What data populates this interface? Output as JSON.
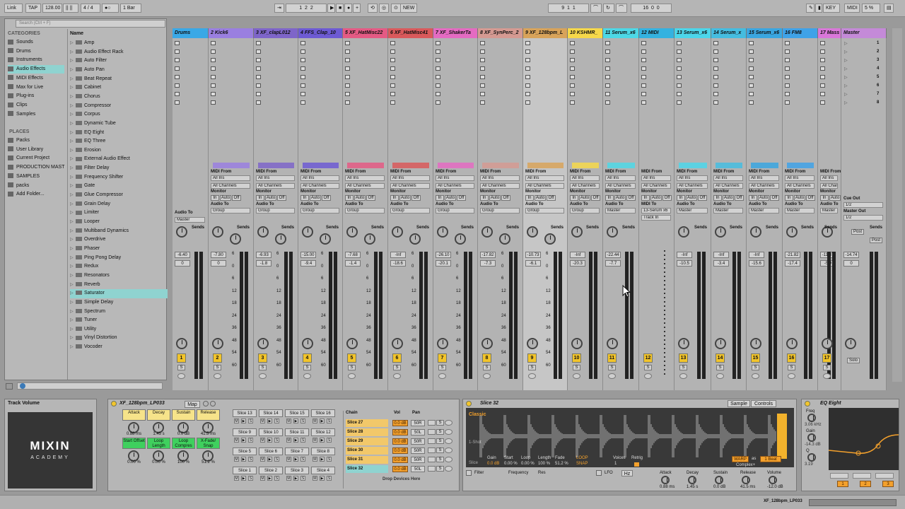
{
  "transport": {
    "link": "Link",
    "tap": "TAP",
    "tempo": "128.00",
    "signature": "4 / 4",
    "quantize": "1 Bar",
    "position": [
      "1",
      "2",
      "2"
    ],
    "new": "NEW",
    "loop_start": [
      "9",
      "1",
      "1"
    ],
    "loop_length": [
      "16",
      "0",
      "0"
    ],
    "key": "KEY",
    "midi": "MIDI",
    "cpu": "5 %"
  },
  "browser": {
    "search_placeholder": "Search (Ctrl + F)",
    "categories_title": "CATEGORIES",
    "categories": [
      {
        "label": "Sounds",
        "icon": "speaker-icon"
      },
      {
        "label": "Drums",
        "icon": "drum-icon"
      },
      {
        "label": "Instruments",
        "icon": "keys-icon"
      },
      {
        "label": "Audio Effects",
        "icon": "audio-fx-icon"
      },
      {
        "label": "MIDI Effects",
        "icon": "midi-fx-icon"
      },
      {
        "label": "Max for Live",
        "icon": "max-icon"
      },
      {
        "label": "Plug-ins",
        "icon": "plugin-icon"
      },
      {
        "label": "Clips",
        "icon": "clip-icon"
      },
      {
        "label": "Samples",
        "icon": "wave-icon"
      }
    ],
    "places_title": "PLACES",
    "places": [
      "Packs",
      "User Library",
      "Current Project",
      "PRODUCTION MAST",
      "SAMPLES",
      "packs",
      "Add Folder..."
    ],
    "name_header": "Name",
    "items": [
      "Amp",
      "Audio Effect Rack",
      "Auto Filter",
      "Auto Pan",
      "Beat Repeat",
      "Cabinet",
      "Chorus",
      "Compressor",
      "Corpus",
      "Dynamic Tube",
      "EQ Eight",
      "EQ Three",
      "Erosion",
      "External Audio Effect",
      "Filter Delay",
      "Frequency Shifter",
      "Gate",
      "Glue Compressor",
      "Grain Delay",
      "Limiter",
      "Looper",
      "Multiband Dynamics",
      "Overdrive",
      "Phaser",
      "Ping Pong Delay",
      "Redux",
      "Resonators",
      "Reverb",
      "Saturator",
      "Simple Delay",
      "Spectrum",
      "Tuner",
      "Utility",
      "Vinyl Distortion",
      "Vocoder"
    ]
  },
  "tracks": [
    {
      "name": "Drums",
      "color": "#3aa8e6",
      "num": "1",
      "vol": "-6.40",
      "pan": "0",
      "route": "Audio To",
      "dest": "Master"
    },
    {
      "name": "2 Kick6",
      "color": "#9a7fe0",
      "num": "2",
      "vol": "-7.80",
      "pan": "0",
      "route": "Audio To",
      "dest": "Group"
    },
    {
      "name": "3 XF_clapL012",
      "color": "#7e65c9",
      "num": "3",
      "vol": "-6.93",
      "pan": "-1.8",
      "route": "Audio To",
      "dest": "Group"
    },
    {
      "name": "4 FFS_Clap_10",
      "color": "#6d5ad3",
      "num": "4",
      "vol": "-15.00",
      "pan": "-9.4",
      "route": "Audio To",
      "dest": "Group"
    },
    {
      "name": "5 XF_HatMisc22",
      "color": "#e45a84",
      "num": "5",
      "vol": "-7.68",
      "pan": "-1.4",
      "route": "Audio To",
      "dest": "Group"
    },
    {
      "name": "6 XF_HatMisc41",
      "color": "#d9595b",
      "num": "6",
      "vol": "-Inf",
      "pan": "-18.6",
      "route": "Audio To",
      "dest": "Group"
    },
    {
      "name": "7 XF_ShakerTa",
      "color": "#e46bc2",
      "num": "7",
      "vol": "-26.10",
      "pan": "-20.1",
      "route": "Audio To",
      "dest": "Group"
    },
    {
      "name": "8 XF_SynPerc_2",
      "color": "#d59a92",
      "num": "8",
      "vol": "-17.82",
      "pan": "-7.3",
      "route": "Audio To",
      "dest": "Group"
    },
    {
      "name": "9 XF_128bpm_L",
      "color": "#d8a35a",
      "num": "9",
      "vol": "-10.73",
      "pan": "-6.1",
      "route": "Audio To",
      "dest": "Group"
    },
    {
      "name": "10 KSHMR_",
      "color": "#f6d84a",
      "num": "10",
      "vol": "-Inf",
      "pan": "-20.3",
      "route": "Audio To",
      "dest": "Group"
    },
    {
      "name": "11 Serum_x6",
      "color": "#4dd8e6",
      "num": "11",
      "vol": "-22.44",
      "pan": "-7.7",
      "route": "Audio To",
      "dest": "Master"
    },
    {
      "name": "12 MIDI",
      "color": "#34b2e0",
      "num": "12",
      "vol": "",
      "pan": "",
      "route": "MIDI To",
      "dest": "13-Serum x6"
    },
    {
      "name": "13 Serum_x6",
      "color": "#4cd6ea",
      "num": "13",
      "vol": "-Inf",
      "pan": "-10.5",
      "route": "Audio To",
      "dest": "Master"
    },
    {
      "name": "14 Serum_x",
      "color": "#45bde0",
      "num": "14",
      "vol": "-Inf",
      "pan": "-3.4",
      "route": "Audio To",
      "dest": "Master"
    },
    {
      "name": "15 Serum_x6",
      "color": "#3aa6e0",
      "num": "15",
      "vol": "-Inf",
      "pan": "-15.6",
      "route": "Audio To",
      "dest": "Master"
    },
    {
      "name": "16 FM8",
      "color": "#3fa2e8",
      "num": "16",
      "vol": "-21.82",
      "pan": "-17.4",
      "route": "Audio To",
      "dest": "Master"
    },
    {
      "name": "17 Mass",
      "color": "#d977d9",
      "num": "17",
      "vol": "-11.87",
      "pan": "-5.9",
      "route": "Audio To",
      "dest": "Master"
    }
  ],
  "master": {
    "name": "Master",
    "color": "#c48ad8",
    "vol": "-14.74",
    "pan": "0",
    "cue_out": "Cue Out",
    "cue_val": "1/2",
    "master_out": "Master Out",
    "master_val": "1/2",
    "scenes": [
      "1",
      "2",
      "3",
      "4",
      "5",
      "6",
      "7",
      "8"
    ]
  },
  "mixer_labels": {
    "midi_from": "MIDI From",
    "all_ins": "All Ins",
    "all_channels": "All Channels",
    "monitor": "Monitor",
    "in": "In",
    "auto": "Auto",
    "off": "Off",
    "sends": "Sends",
    "s": "S",
    "track_in": "Track In",
    "post": "Post",
    "solo": "Solo"
  },
  "db_scale": [
    "6",
    "0",
    "6",
    "12",
    "18",
    "24",
    "36",
    "48",
    "54",
    "60"
  ],
  "bottom": {
    "track_volume": "Track Volume",
    "logo_text": "MIXIN",
    "logo_sub": "ACADEMY",
    "rack_name": "XF_128bpm_LP033",
    "map": "Map",
    "macros": [
      {
        "label": "Attack",
        "value": "0.88 ms"
      },
      {
        "label": "Decay",
        "value": "1.45 s"
      },
      {
        "label": "Sustain",
        "value": "0.0 dB"
      },
      {
        "label": "Release",
        "value": "41.5 ms"
      },
      {
        "label": "Start Offset",
        "value": "0.00 %"
      },
      {
        "label": "Loop Length",
        "value": "0.00 %"
      },
      {
        "label": "Loop Compres",
        "value": "100 %"
      },
      {
        "label": "X-Fade/ Snap",
        "value": "51.2 %"
      }
    ],
    "pads": [
      "Slice 13",
      "Slice 14",
      "Slice 15",
      "Slice 16",
      "Slice 9",
      "Slice 10",
      "Slice 11",
      "Slice 12",
      "Slice 5",
      "Slice 6",
      "Slice 7",
      "Slice 8",
      "Slice 1",
      "Slice 2",
      "Slice 3",
      "Slice 4"
    ],
    "chain_header": [
      "Chain",
      "Vol",
      "Pan"
    ],
    "chains": [
      {
        "name": "Slice 27",
        "vol": "0.0 dB",
        "pan": "50R"
      },
      {
        "name": "Slice 28",
        "vol": "0.0 dB",
        "pan": "50L"
      },
      {
        "name": "Slice 29",
        "vol": "0.0 dB",
        "pan": "50R"
      },
      {
        "name": "Slice 30",
        "vol": "0.0 dB",
        "pan": "50R"
      },
      {
        "name": "Slice 31",
        "vol": "0.0 dB",
        "pan": "50R"
      },
      {
        "name": "Slice 32",
        "vol": "0.0 dB",
        "pan": "50L"
      }
    ],
    "drop_devices": "Drop Devices Here",
    "simpler_title": "Slice 32",
    "simpler_tabs": [
      "Sample",
      "Controls"
    ],
    "simpler_mode": "Classic",
    "simpler_modes": [
      "1-Shot",
      "Slice"
    ],
    "simpler_params": [
      {
        "label": "Gain",
        "value": "0.0 dB"
      },
      {
        "label": "Start",
        "value": "0.00 %"
      },
      {
        "label": "Loop",
        "value": "0.00 %"
      },
      {
        "label": "Length",
        "value": "100 %"
      },
      {
        "label": "Fade",
        "value": "51.2 %"
      }
    ],
    "simpler_loop": "LOOP",
    "simpler_snap": "SNAP",
    "simpler_voices_label": "Voices",
    "simpler_voices": "1",
    "simpler_retrig": "Retrig",
    "warp": "WARP",
    "warp_as": "as",
    "warp_beats": "1 Beat",
    "warp_mode": "Complex+",
    "filter": "Filter",
    "frequency": "Frequency",
    "res": "Res",
    "lfo": "LFO",
    "hz": "Hz",
    "env": [
      {
        "label": "Attack",
        "value": "0.88 ms"
      },
      {
        "label": "Decay",
        "value": "1.45 s"
      },
      {
        "label": "Sustain",
        "value": "0.0 dB"
      },
      {
        "label": "Release",
        "value": "41.5 ms"
      },
      {
        "label": "Volume",
        "value": "-12.0 dB"
      }
    ],
    "eq_title": "EQ Eight",
    "eq_params": [
      {
        "label": "Freq",
        "value": "3.06 kHz"
      },
      {
        "label": "Gain",
        "value": "-14.3 dB"
      },
      {
        "label": "Q",
        "value": "3.19"
      }
    ],
    "eq_bands": [
      "1",
      "2",
      "3"
    ]
  },
  "status": {
    "clip_name": "XF_128bpm_LP033"
  }
}
